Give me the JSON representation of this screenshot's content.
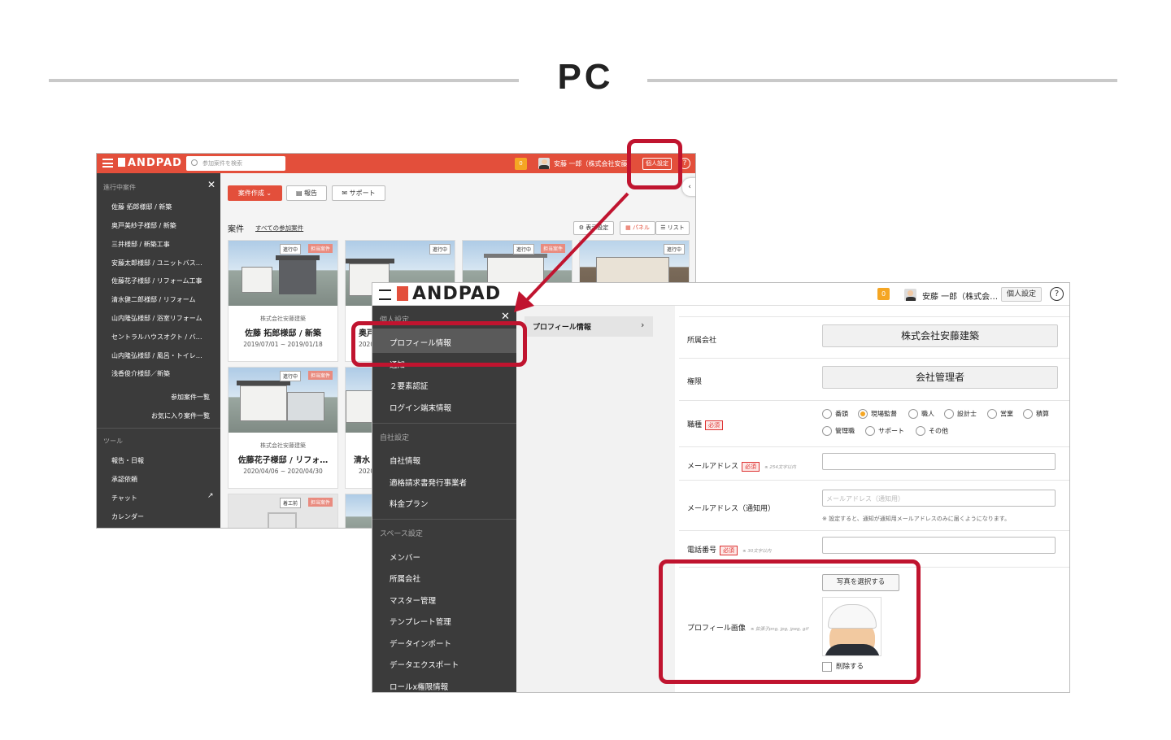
{
  "heading": "PC",
  "colors": {
    "andpad_red": "#e34f3b",
    "highlight": "#c0142f",
    "sidebar": "#3b3b3b",
    "badge": "#f5a623"
  },
  "win1": {
    "logo": "ANDPAD",
    "search_placeholder": "参加案件を検索",
    "notif_count": "0",
    "user": "安藤 一郎（株式会社安藤",
    "personal_settings": "個人設定",
    "help": "?",
    "sidebar": {
      "section1": "進行中案件",
      "projects": [
        "佐藤 拓郎様邸 / 新築",
        "奥戸美紗子様邸 / 新築",
        "三井様邸 / 新築工事",
        "安藤太郎様邸 / ユニットバス…",
        "佐藤花子様邸 / リフォーム工事",
        "清水健二郎様邸 / リフォーム",
        "山内隆弘様邸 / 浴室リフォーム",
        "セントラルハウスオクト / バ…",
        "山内隆弘様邸 / 風呂・トイレ…",
        "浅香俊介様邸／新築"
      ],
      "link_all": "参加案件一覧",
      "link_fav": "お気に入り案件一覧",
      "section2": "ツール",
      "tools": [
        "報告・日報",
        "承認依頼",
        "チャット",
        "カレンダー"
      ]
    },
    "toolbar": {
      "create": "案件作成",
      "report": "報告",
      "support": "サポート"
    },
    "list_title": "案件",
    "all_link": "すべての参加案件",
    "view": {
      "settings": "表示設定",
      "panel": "パネル",
      "list": "リスト"
    },
    "cards": [
      {
        "tag1": "進行中",
        "tag2": "担当案件",
        "company": "株式会社安藤建築",
        "name": "佐藤 拓郎様邸 / 新築",
        "date": "2019/07/01 ~ 2019/01/18"
      },
      {
        "tag1": "進行中",
        "tag2": "",
        "company": "",
        "name": "奥戸",
        "date": "2020"
      },
      {
        "tag1": "進行中",
        "tag2": "担当案件",
        "company": "",
        "name": "",
        "date": ""
      },
      {
        "tag1": "進行中",
        "tag2": "",
        "company": "",
        "name": "",
        "date": ""
      },
      {
        "tag1": "進行中",
        "tag2": "担当案件",
        "company": "株式会社安藤建築",
        "name": "佐藤花子様邸 / リフォ…",
        "date": "2020/04/06 ~ 2020/04/30"
      },
      {
        "tag1": "",
        "tag2": "",
        "company": "",
        "name": "清水",
        "date": "2020"
      },
      {
        "tag1": "着工前",
        "tag2": "担当案件",
        "company": "",
        "name": "",
        "date": ""
      }
    ]
  },
  "win2": {
    "logo": "ANDPAD",
    "notif_count": "0",
    "user": "安藤 一郎（株式会…",
    "personal_settings": "個人設定",
    "help": "?",
    "sidebar": {
      "section1": "個人設定",
      "items1": [
        "プロフィール情報",
        "通知",
        "２要素認証",
        "ログイン端末情報"
      ],
      "section2": "自社設定",
      "items2": [
        "自社情報",
        "適格請求書発行事業者",
        "料金プラン"
      ],
      "section3": "スペース設定",
      "items3": [
        "メンバー",
        "所属会社",
        "マスター管理",
        "テンプレート管理",
        "データインポート",
        "データエクスポート",
        "ロールx権限情報"
      ]
    },
    "sub_item": "プロフィール情報",
    "form": {
      "company_label": "所属会社",
      "company_value": "株式会社安藤建築",
      "role_label": "権限",
      "role_value": "会社管理者",
      "job_label": "職種",
      "required": "必須",
      "job_options": [
        "番頭",
        "現場監督",
        "職人",
        "設計士",
        "営業",
        "積算",
        "管理職",
        "サポート",
        "その他"
      ],
      "email_label": "メールアドレス",
      "email_hint": "※ 254文字以内",
      "notify_email_label": "メールアドレス（通知用）",
      "notify_email_placeholder": "メールアドレス（通知用）",
      "notify_email_note": "※ 設定すると、通知が通知用メールアドレスのみに届くようになります。",
      "phone_label": "電話番号",
      "phone_hint": "※ 30文字以内",
      "image_label": "プロフィール画像",
      "image_hint": "※ 拡張子png, jpg, jpeg, gif",
      "select_photo": "写真を選択する",
      "delete": "削除する"
    }
  }
}
